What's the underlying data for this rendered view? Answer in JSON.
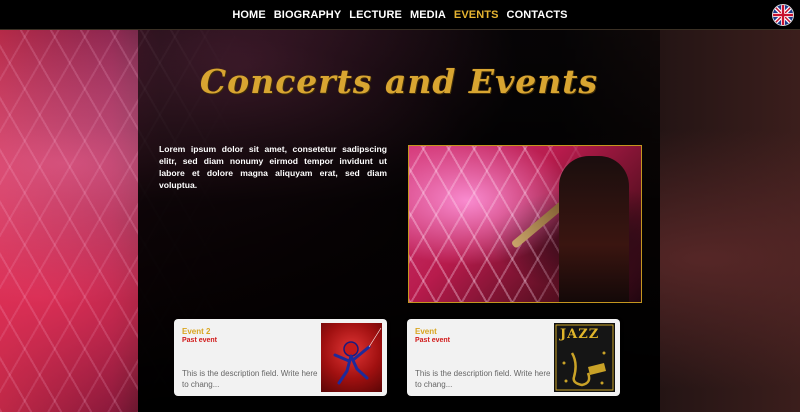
{
  "nav": {
    "items": [
      "HOME",
      "BIOGRAPHY",
      "LECTURE",
      "MEDIA",
      "EVENTS",
      "CONTACTS"
    ],
    "active": "EVENTS"
  },
  "language_flag": "uk-flag-icon",
  "page": {
    "title": "Concerts and Events",
    "intro": "Lorem ipsum dolor sit amet, consetetur sadipscing elitr, sed diam nonumy eirmod tempor invidunt ut labore et dolore magna aliquyam erat, sed diam voluptua."
  },
  "events": [
    {
      "title": "Event 2",
      "status": "Past event",
      "description": "This is the description field. Write here to chang...",
      "thumbnail": "spider-man-poster"
    },
    {
      "title": "Event",
      "status": "Past event",
      "description": "This is the description field. Write here to chang...",
      "thumbnail": "jazz-poster",
      "thumbnail_text": "JAZZ"
    }
  ],
  "colors": {
    "accent_gold": "#d8a531",
    "active_nav": "#e6b431",
    "status_red": "#d11a1a",
    "card_bg": "#f2f2f2"
  }
}
